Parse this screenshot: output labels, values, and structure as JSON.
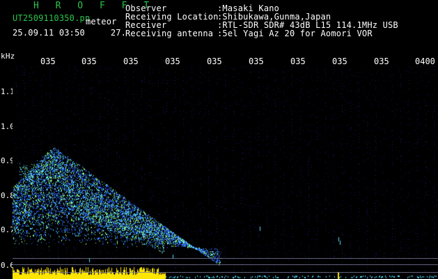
{
  "header": {
    "title": "H R O F F T",
    "filename": "UT2509110350.pn",
    "suffix": "meteor",
    "timestamp": "25.09.11 03:50",
    "count": "27.",
    "rows": [
      {
        "label": "Observer",
        "value": ":Masaki Kano"
      },
      {
        "label": "Receiving Location",
        "value": ":Shibukawa,Gunma,Japan"
      },
      {
        "label": "Receiver",
        "value": ":RTL-SDR SDR# 43dB L15 114.1MHz USB"
      },
      {
        "label": "Receiving antenna",
        "value": ":5el Yagi Az 20 for Aomori VOR"
      }
    ]
  },
  "axis": {
    "unit": "kHz",
    "x_ticks": [
      "035",
      "035",
      "035",
      "035",
      "035",
      "035",
      "035",
      "035",
      "035",
      "0400"
    ],
    "y_ticks": [
      "1.1",
      "1.0",
      "0.9",
      "0.8",
      "0.7",
      "0.6"
    ]
  },
  "colors": {
    "background": "#000000",
    "grid": "#1a1a7a",
    "signal_blue": "#2a6cff",
    "signal_cyan": "#4fe0ff",
    "signal_green": "#9cff5a",
    "baseline_yellow": "#ffe600",
    "text_green": "#29c64a",
    "text_white": "#ffffff"
  }
}
